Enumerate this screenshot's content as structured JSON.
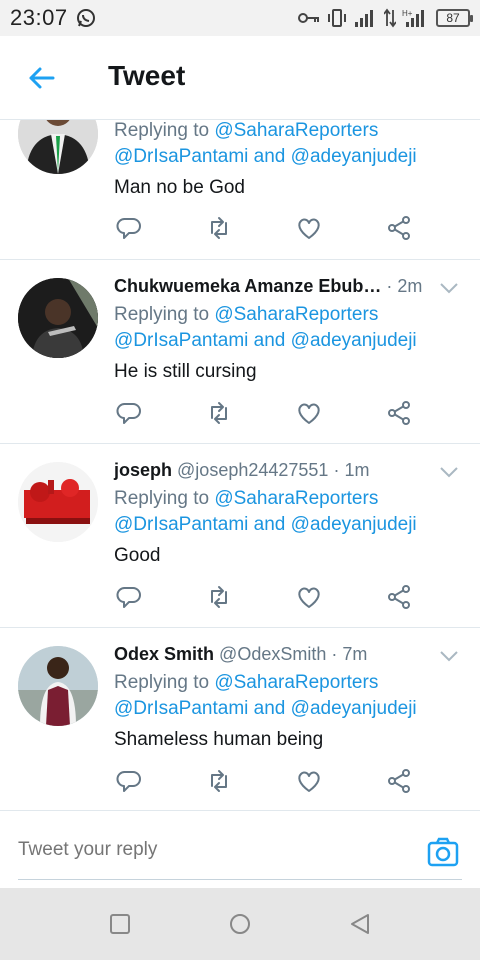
{
  "status_bar": {
    "time": "23:07",
    "battery": "87"
  },
  "header": {
    "title": "Tweet"
  },
  "tweets": [
    {
      "name": "",
      "handle": "",
      "time": "",
      "reply_prefix": "Replying to",
      "reply_to_1": "@SaharaReporters",
      "reply_to_2": "@DrIsaPantami",
      "reply_and": "and",
      "reply_to_3": "@adeyanjudeji",
      "text": "Man no be God"
    },
    {
      "name": "Chukwuemeka Amanze Ebub…",
      "handle": "",
      "time": "· 2m",
      "reply_prefix": "Replying to",
      "reply_to_1": "@SaharaReporters",
      "reply_to_2": "@DrIsaPantami",
      "reply_and": "and",
      "reply_to_3": "@adeyanjudeji",
      "text": "He is still cursing"
    },
    {
      "name": "joseph",
      "handle": "@joseph24427551",
      "time": "· 1m",
      "reply_prefix": "Replying to",
      "reply_to_1": "@SaharaReporters",
      "reply_to_2": "@DrIsaPantami",
      "reply_and": "and",
      "reply_to_3": "@adeyanjudeji",
      "text": "Good"
    },
    {
      "name": "Odex Smith",
      "handle": "@OdexSmith",
      "time": "· 7m",
      "reply_prefix": "Replying to",
      "reply_to_1": "@SaharaReporters",
      "reply_to_2": "@DrIsaPantami",
      "reply_and": "and",
      "reply_to_3": "@adeyanjudeji",
      "text": "Shameless human being"
    }
  ],
  "reply_box": {
    "placeholder": "Tweet your reply"
  },
  "colors": {
    "link": "#1b95e0",
    "secondary": "#657786",
    "accent": "#1da1f2"
  },
  "icons": [
    "back-arrow-icon",
    "reply-icon",
    "retweet-icon",
    "like-icon",
    "share-icon",
    "camera-icon",
    "chevron-down-icon"
  ]
}
